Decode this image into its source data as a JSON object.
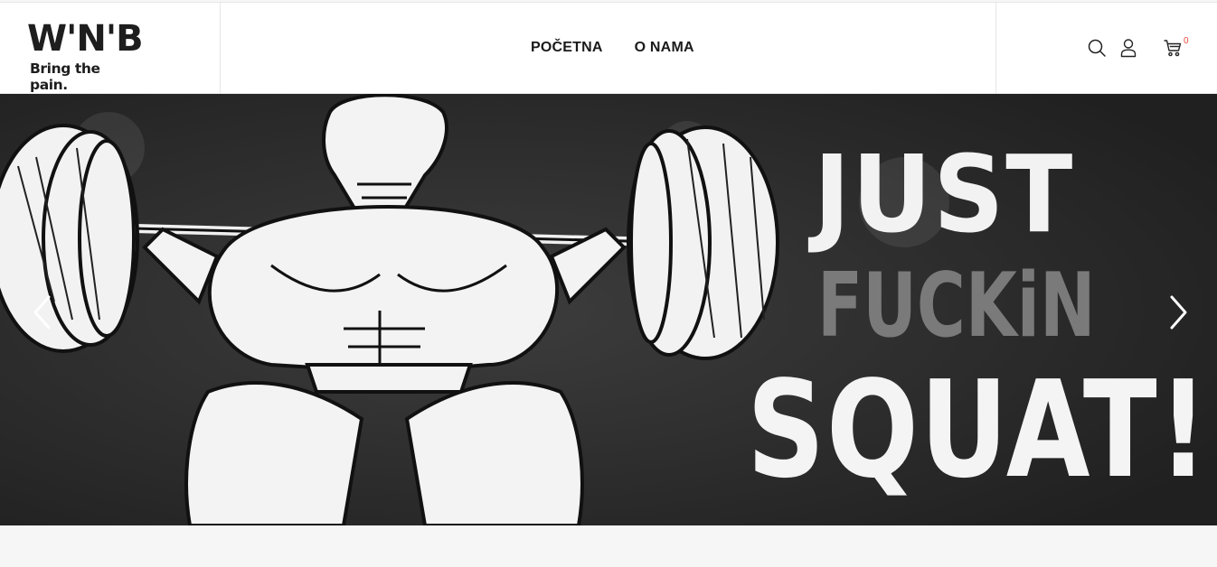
{
  "brand": {
    "name": "W'N'B",
    "tagline": "Bring the pain."
  },
  "nav": {
    "items": [
      {
        "label": "POČETNA"
      },
      {
        "label": "O NAMA"
      }
    ]
  },
  "header_icons": {
    "search": "search-icon",
    "account": "user-icon",
    "cart": "cart-icon",
    "cart_count": "0"
  },
  "hero": {
    "lines": [
      "JUST",
      "FUCKiN",
      "SQUAT!"
    ],
    "prev": "chevron-left-icon",
    "next": "chevron-right-icon"
  },
  "colors": {
    "accent": "#e8473a",
    "hero_bg": "#2e2e2e",
    "slogan_light": "#f2f2f2",
    "slogan_grey": "#7a7a7a"
  }
}
